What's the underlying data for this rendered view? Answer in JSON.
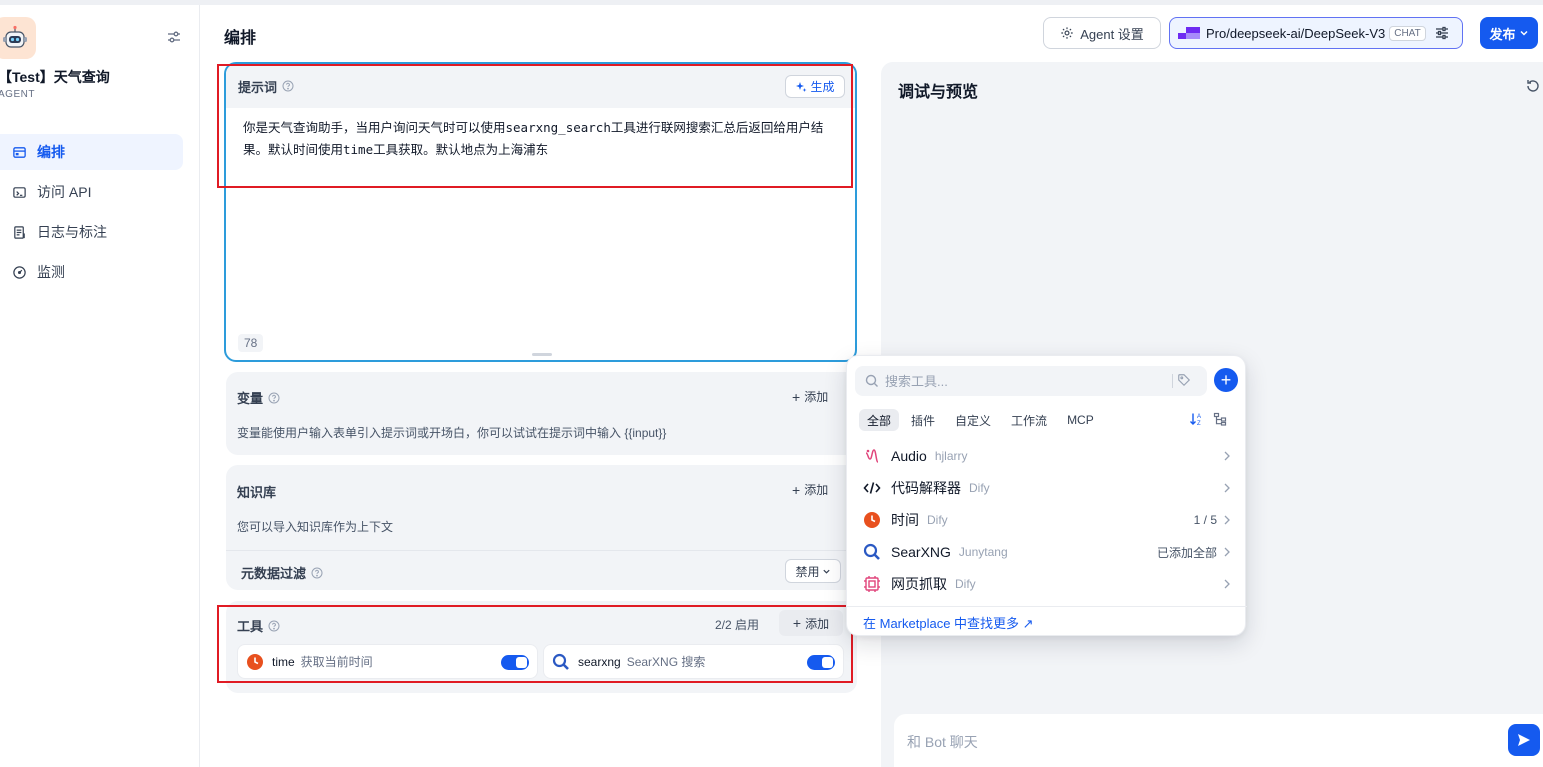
{
  "app": {
    "name": "【Test】天气查询",
    "type": "AGENT"
  },
  "sidebar": {
    "items": [
      {
        "label": "编排",
        "icon": "orchestrate-icon",
        "active": true
      },
      {
        "label": "访问 API",
        "icon": "terminal-icon",
        "active": false
      },
      {
        "label": "日志与标注",
        "icon": "document-icon",
        "active": false
      },
      {
        "label": "监测",
        "icon": "gauge-icon",
        "active": false
      }
    ]
  },
  "header": {
    "title": "编排",
    "agent_settings": "Agent 设置",
    "model_name": "Pro/deepseek-ai/DeepSeek-V3",
    "model_badge": "CHAT",
    "publish": "发布"
  },
  "prompt": {
    "label": "提示词",
    "generate": "生成",
    "text": "你是天气查询助手，当用户询问天气时可以使用searxng_search工具进行联网搜索汇总后返回给用户结果。默认时间使用time工具获取。默认地点为上海浦东",
    "char_count": "78"
  },
  "variables": {
    "label": "变量",
    "add": "添加",
    "description": "变量能使用户输入表单引入提示词或开场白，你可以试试在提示词中输入 {{input}}"
  },
  "knowledge": {
    "label": "知识库",
    "add": "添加",
    "description": "您可以导入知识库作为上下文",
    "metadata_filter_label": "元数据过滤",
    "metadata_filter_value": "禁用"
  },
  "tools": {
    "label": "工具",
    "count": "2/2 启用",
    "add": "添加",
    "items": [
      {
        "name": "time",
        "description": "获取当前时间",
        "icon": "clock-icon",
        "enabled": true
      },
      {
        "name": "searxng",
        "description": "SearXNG 搜索",
        "icon": "magnifier-icon",
        "enabled": true
      }
    ]
  },
  "debug": {
    "title": "调试与预览",
    "chat_placeholder": "和 Bot 聊天"
  },
  "tool_picker": {
    "search_placeholder": "搜索工具...",
    "tabs": [
      "全部",
      "插件",
      "自定义",
      "工作流",
      "MCP"
    ],
    "active_tab": "全部",
    "items": [
      {
        "name": "Audio",
        "author": "hjlarry",
        "right": "",
        "icon": "audio-icon"
      },
      {
        "name": "代码解释器",
        "author": "Dify",
        "right": "",
        "icon": "code-icon"
      },
      {
        "name": "时间",
        "author": "Dify",
        "right": "1 / 5",
        "icon": "clock-icon"
      },
      {
        "name": "SearXNG",
        "author": "Junytang",
        "right": "已添加全部",
        "icon": "magnifier-icon"
      },
      {
        "name": "网页抓取",
        "author": "Dify",
        "right": "",
        "icon": "web-scraper-icon"
      }
    ],
    "marketplace_link": "在 Marketplace 中查找更多 ↗"
  },
  "colors": {
    "primary": "#155aef",
    "annotation_red": "#e01b24",
    "card_bg": "#f2f4f7",
    "clock_orange": "#e8501e",
    "audio_pink": "#e0457b"
  }
}
